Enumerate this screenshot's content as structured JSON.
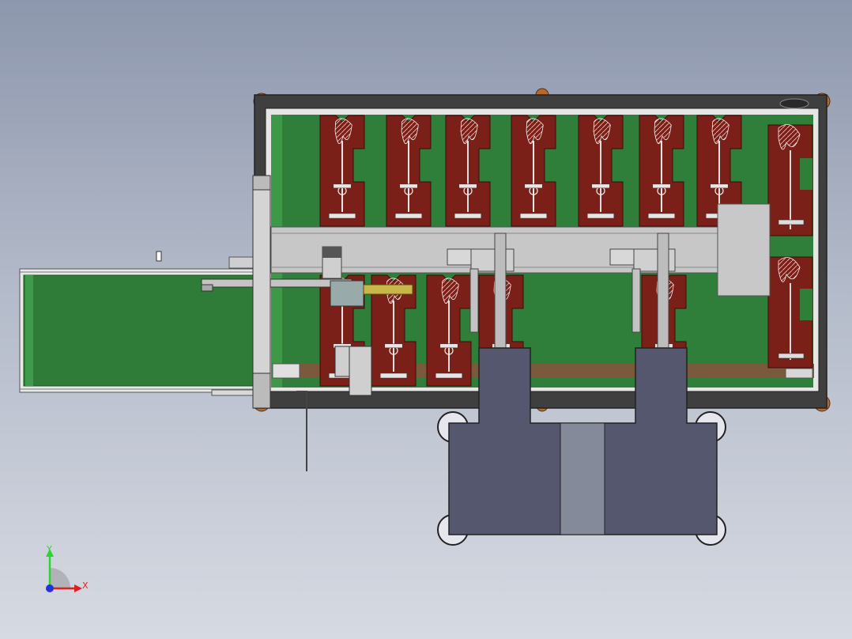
{
  "triad": {
    "y_label": "Y",
    "x_label": "X",
    "y_color": "#2bd62b",
    "x_color": "#e02020",
    "z_color": "#2233dd"
  },
  "colors": {
    "frame": "#4a4a4a",
    "bed": "#2f7f3a",
    "bed_dark": "#1f5f28",
    "panel": "#7a2018",
    "rail": "#c7c7c7",
    "conveyor": "#2e7c37",
    "press_body": "#55576f",
    "press_center": "#858a9a",
    "foot": "#b36a2c"
  },
  "layout": {
    "top_molds": 8,
    "bottom_molds": 6
  }
}
